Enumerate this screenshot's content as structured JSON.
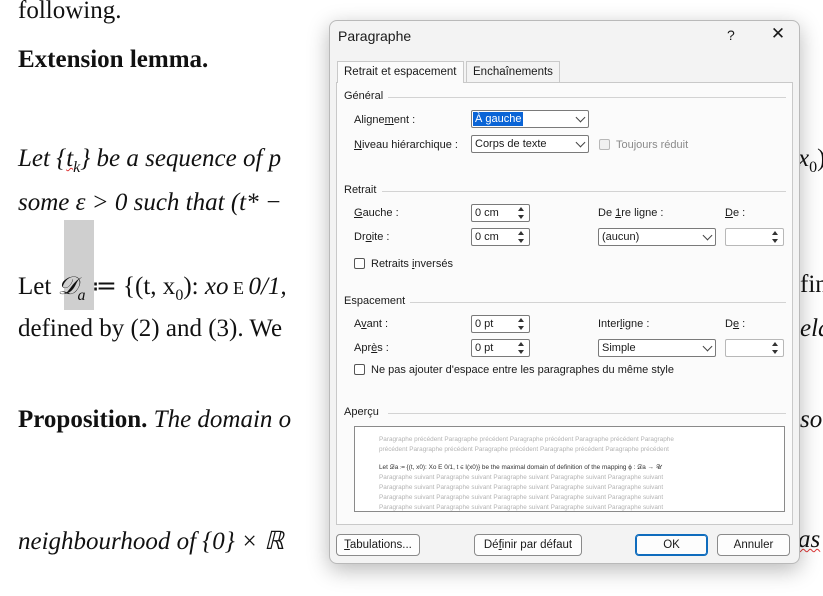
{
  "document": {
    "line0": "following.",
    "heading1": "Extension lemma.",
    "line2_a": "Let {",
    "line2_t": "t",
    "line2_k": "k",
    "line2_b": "} be a sequence of p",
    "line2_c": "x",
    "line2_d": "0",
    "line2_e": ")",
    "line3": "some ε > 0 such that (t* −",
    "line4_a": "Let ",
    "line4_D": "𝒟",
    "line4_sub": "a",
    "line4_b": " ≔ {(t, x",
    "line4_c": "0",
    "line4_d": "): ",
    "line4_e": "xo",
    "line4_f": " E ",
    "line4_g": "0/1,",
    "line4_end": "fin",
    "line5_a": "defined by (2) and (3). We",
    "line5_end": "eld",
    "prop_bold": "Proposition.",
    "prop_it": " The domain o",
    "prop_end": "so",
    "line7": "neighbourhood of {0} × ℝ",
    "line7_end": "as"
  },
  "dialog": {
    "title": "Paragraphe",
    "help_label": "?",
    "close_label": "✕",
    "tabs": [
      {
        "label": "Retrait et espacement",
        "active": true
      },
      {
        "label": "Enchaînements",
        "active": false
      }
    ],
    "general": {
      "heading": "Général",
      "alignment_label_pre": "Aligne",
      "alignment_label_u": "m",
      "alignment_label_post": "ent :",
      "alignment_value": "À gauche",
      "outline_label_pre": "",
      "outline_label_u": "N",
      "outline_label_post": "iveau hiérarchique :",
      "outline_value": "Corps de texte",
      "collapsed_label": "Toujours réduit"
    },
    "indent": {
      "heading": "Retrait",
      "left_label_pre": "",
      "left_label_u": "G",
      "left_label_post": "auche :",
      "left_value": "0 cm",
      "right_label_pre": "Dr",
      "right_label_u": "o",
      "right_label_post": "ite :",
      "right_value": "0 cm",
      "first_line_label_pre": "De ",
      "first_line_label_u": "1",
      "first_line_label_post": "re ligne :",
      "first_line_value": "(aucun)",
      "by_label_pre": "",
      "by_label_u": "D",
      "by_label_post": "e :",
      "by_value": "",
      "mirror_label_pre": "Retraits ",
      "mirror_label_u": "i",
      "mirror_label_post": "nversés"
    },
    "spacing": {
      "heading": "Espacement",
      "before_label_pre": "A",
      "before_label_u": "v",
      "before_label_post": "ant :",
      "before_value": "0 pt",
      "after_label_pre": "Apr",
      "after_label_u": "è",
      "after_label_post": "s :",
      "after_value": "0 pt",
      "line_label_pre": "Inter",
      "line_label_u": "l",
      "line_label_post": "igne :",
      "line_value": "Simple",
      "at_label_pre": "D",
      "at_label_u": "e",
      "at_label_post": " :",
      "at_value": "",
      "no_space_label": "Ne pas ajouter d'espace entre les paragraphes du même style"
    },
    "preview": {
      "heading": "Aperçu",
      "prev_line1": "Paragraphe précédent Paragraphe précédent Paragraphe précédent Paragraphe précédent Paragraphe",
      "prev_line2": "précédent Paragraphe précédent Paragraphe précédent Paragraphe précédent Paragraphe précédent",
      "current_line": "Let 𝒟a ≔ {(t, x0): Xo E 0/1, t ∈ I(x0)} be the maximal domain of definition of the mapping ϕ : 𝒟a → 𝒰",
      "next_line1": "Paragraphe suivant Paragraphe suivant Paragraphe suivant Paragraphe suivant Paragraphe suivant",
      "next_line2": "Paragraphe suivant Paragraphe suivant Paragraphe suivant Paragraphe suivant Paragraphe suivant",
      "next_line3": "Paragraphe suivant Paragraphe suivant Paragraphe suivant Paragraphe suivant Paragraphe suivant",
      "next_line4": "Paragraphe suivant Paragraphe suivant Paragraphe suivant Paragraphe suivant Paragraphe suivant"
    },
    "buttons": {
      "tabs_label_pre": "",
      "tabs_label_u": "T",
      "tabs_label_post": "abulations...",
      "default_label_pre": "Dé",
      "default_label_u": "f",
      "default_label_post": "inir par défaut",
      "ok_label": "OK",
      "cancel_label": "Annuler"
    }
  },
  "colors": {
    "accent": "#0f6cbd",
    "selection": "#0a64d6",
    "spellcheck": "#dd3333"
  }
}
